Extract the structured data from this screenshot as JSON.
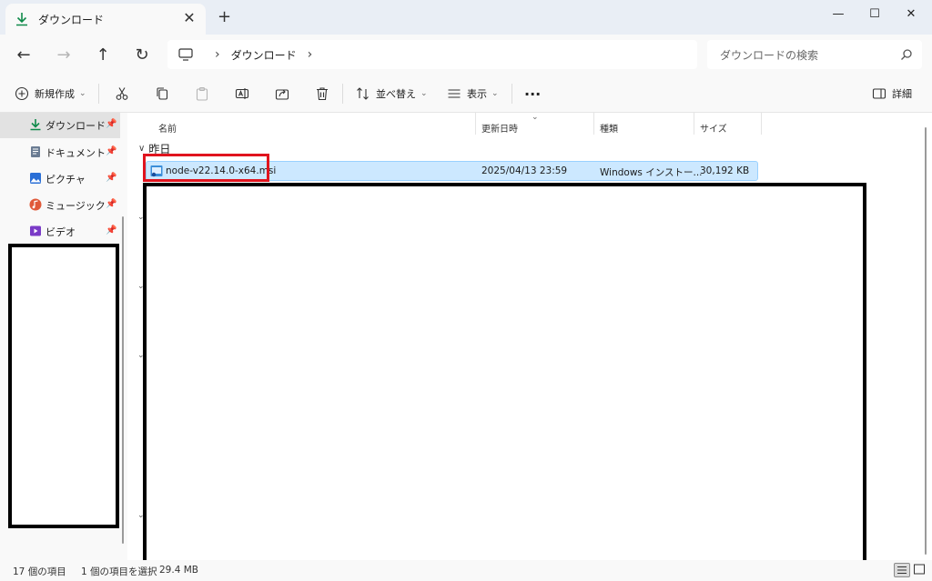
{
  "window": {
    "tab_title": "ダウンロード",
    "tab_close": "✕",
    "new_tab": "+",
    "minimize": "—",
    "maximize": "☐",
    "close": "✕"
  },
  "nav": {
    "back": "←",
    "forward": "→",
    "up": "↑",
    "refresh": "↻",
    "breadcrumb": [
      "ダウンロード"
    ],
    "crumb_separator": "›",
    "search_placeholder": "ダウンロードの検索"
  },
  "toolbar": {
    "new_label": "新規作成",
    "sort_label": "並べ替え",
    "view_label": "表示",
    "more_label": "···",
    "details_label": "詳細"
  },
  "sidebar": {
    "items": [
      {
        "label": "ダウンロード",
        "icon": "download-icon",
        "selected": true
      },
      {
        "label": "ドキュメント",
        "icon": "document-icon",
        "selected": false
      },
      {
        "label": "ピクチャ",
        "icon": "pictures-icon",
        "selected": false
      },
      {
        "label": "ミュージック",
        "icon": "music-icon",
        "selected": false
      },
      {
        "label": "ビデオ",
        "icon": "video-icon",
        "selected": false
      }
    ]
  },
  "columns": {
    "name": "名前",
    "modified": "更新日時",
    "type": "種類",
    "size": "サイズ"
  },
  "group": {
    "label": "昨日",
    "chevron": "∨"
  },
  "files": [
    {
      "name": "node-v22.14.0-x64.msi",
      "modified": "2025/04/13 23:59",
      "type": "Windows インストー...",
      "size": "30,192 KB"
    }
  ],
  "status": {
    "item_count": "17 個の項目",
    "selected": "1 個の項目を選択",
    "selected_size": "29.4 MB"
  },
  "colors": {
    "selection_bg": "#cce8ff",
    "accent": "#0a7a3e",
    "highlight_box": "#e0141e"
  }
}
